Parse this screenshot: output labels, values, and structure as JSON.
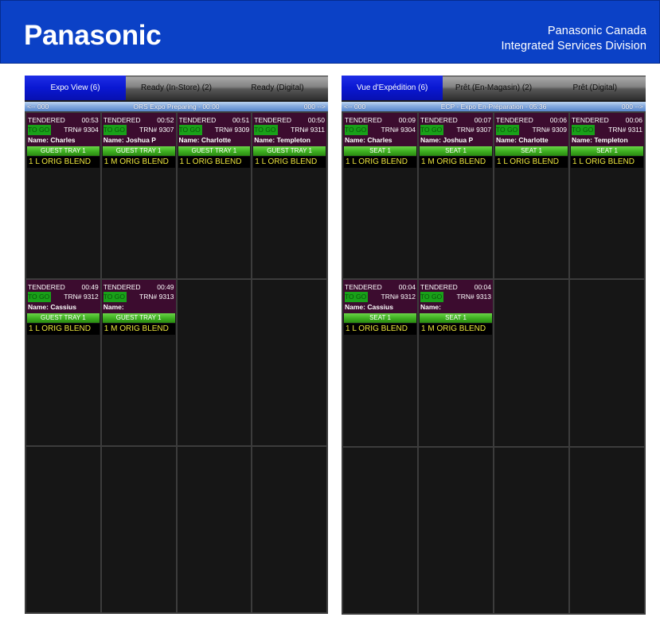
{
  "header": {
    "logo": "Panasonic",
    "company": "Panasonic Canada",
    "division": "Integrated Services Division"
  },
  "colors": {
    "brand_blue": "#0b41c6",
    "active_tab": "#0a18d2",
    "ticket_header": "#3c0c2f",
    "to_go": "#19a019",
    "seat_bar": "#3fb022",
    "item_text": "#ebe53c"
  },
  "panels": [
    {
      "tabs": [
        {
          "label": "Expo View (6)",
          "active": true
        },
        {
          "label": "Ready (In-Store) (2)",
          "active": false
        },
        {
          "label": "Ready (Digital)",
          "active": false
        }
      ],
      "status_bar": {
        "prev": "<-- 000",
        "title": "ORS Expo Preparing - 00:00",
        "next": "000 -->"
      },
      "orders": [
        {
          "status": "TENDERED",
          "timer": "00:53",
          "type": "TO GO",
          "trn": "TRN# 9304",
          "name": "Name: Charles",
          "seat": "GUEST TRAY 1",
          "items": [
            "1 L ORIG BLEND"
          ]
        },
        {
          "status": "TENDERED",
          "timer": "00:52",
          "type": "TO GO",
          "trn": "TRN# 9307",
          "name": "Name: Joshua P",
          "seat": "GUEST TRAY 1",
          "items": [
            "1 M ORIG BLEND"
          ]
        },
        {
          "status": "TENDERED",
          "timer": "00:51",
          "type": "TO GO",
          "trn": "TRN# 9309",
          "name": "Name: Charlotte",
          "seat": "GUEST TRAY 1",
          "items": [
            "1 L ORIG BLEND"
          ]
        },
        {
          "status": "TENDERED",
          "timer": "00:50",
          "type": "TO GO",
          "trn": "TRN# 9311",
          "name": "Name: Templeton",
          "seat": "GUEST TRAY 1",
          "items": [
            "1 L ORIG BLEND"
          ]
        },
        {
          "status": "TENDERED",
          "timer": "00:49",
          "type": "TO GO",
          "trn": "TRN# 9312",
          "name": "Name: Cassius",
          "seat": "GUEST TRAY 1",
          "items": [
            "1 L ORIG BLEND"
          ]
        },
        {
          "status": "TENDERED",
          "timer": "00:49",
          "type": "TO GO",
          "trn": "TRN# 9313",
          "name": "Name:",
          "seat": "GUEST TRAY 1",
          "items": [
            "1 M ORIG BLEND"
          ]
        }
      ]
    },
    {
      "tabs": [
        {
          "label": "Vue d'Expédition (6)",
          "active": true
        },
        {
          "label": "Prêt (En-Magasin) (2)",
          "active": false
        },
        {
          "label": "Prêt (Digital)",
          "active": false
        }
      ],
      "status_bar": {
        "prev": "<-- 000",
        "title": "ÉCP - Expo En-Préparation - 05:36",
        "next": "000 -->"
      },
      "orders": [
        {
          "status": "TENDERED",
          "timer": "00:09",
          "type": "TO GO",
          "trn": "TRN# 9304",
          "name": "Name: Charles",
          "seat": "SEAT 1",
          "items": [
            "1 L ORIG BLEND"
          ]
        },
        {
          "status": "TENDERED",
          "timer": "00:07",
          "type": "TO GO",
          "trn": "TRN# 9307",
          "name": "Name: Joshua P",
          "seat": "SEAT 1",
          "items": [
            "1 M ORIG BLEND"
          ]
        },
        {
          "status": "TENDERED",
          "timer": "00:06",
          "type": "TO GO",
          "trn": "TRN# 9309",
          "name": "Name: Charlotte",
          "seat": "SEAT 1",
          "items": [
            "1 L ORIG BLEND"
          ]
        },
        {
          "status": "TENDERED",
          "timer": "00:06",
          "type": "TO GO",
          "trn": "TRN# 9311",
          "name": "Name: Templeton",
          "seat": "SEAT 1",
          "items": [
            "1 L ORIG BLEND"
          ]
        },
        {
          "status": "TENDERED",
          "timer": "00:04",
          "type": "TO GO",
          "trn": "TRN# 9312",
          "name": "Name: Cassius",
          "seat": "SEAT 1",
          "items": [
            "1 L ORIG BLEND"
          ]
        },
        {
          "status": "TENDERED",
          "timer": "00:04",
          "type": "TO GO",
          "trn": "TRN# 9313",
          "name": "Name:",
          "seat": "SEAT 1",
          "items": [
            "1 M ORIG BLEND"
          ]
        }
      ]
    }
  ]
}
